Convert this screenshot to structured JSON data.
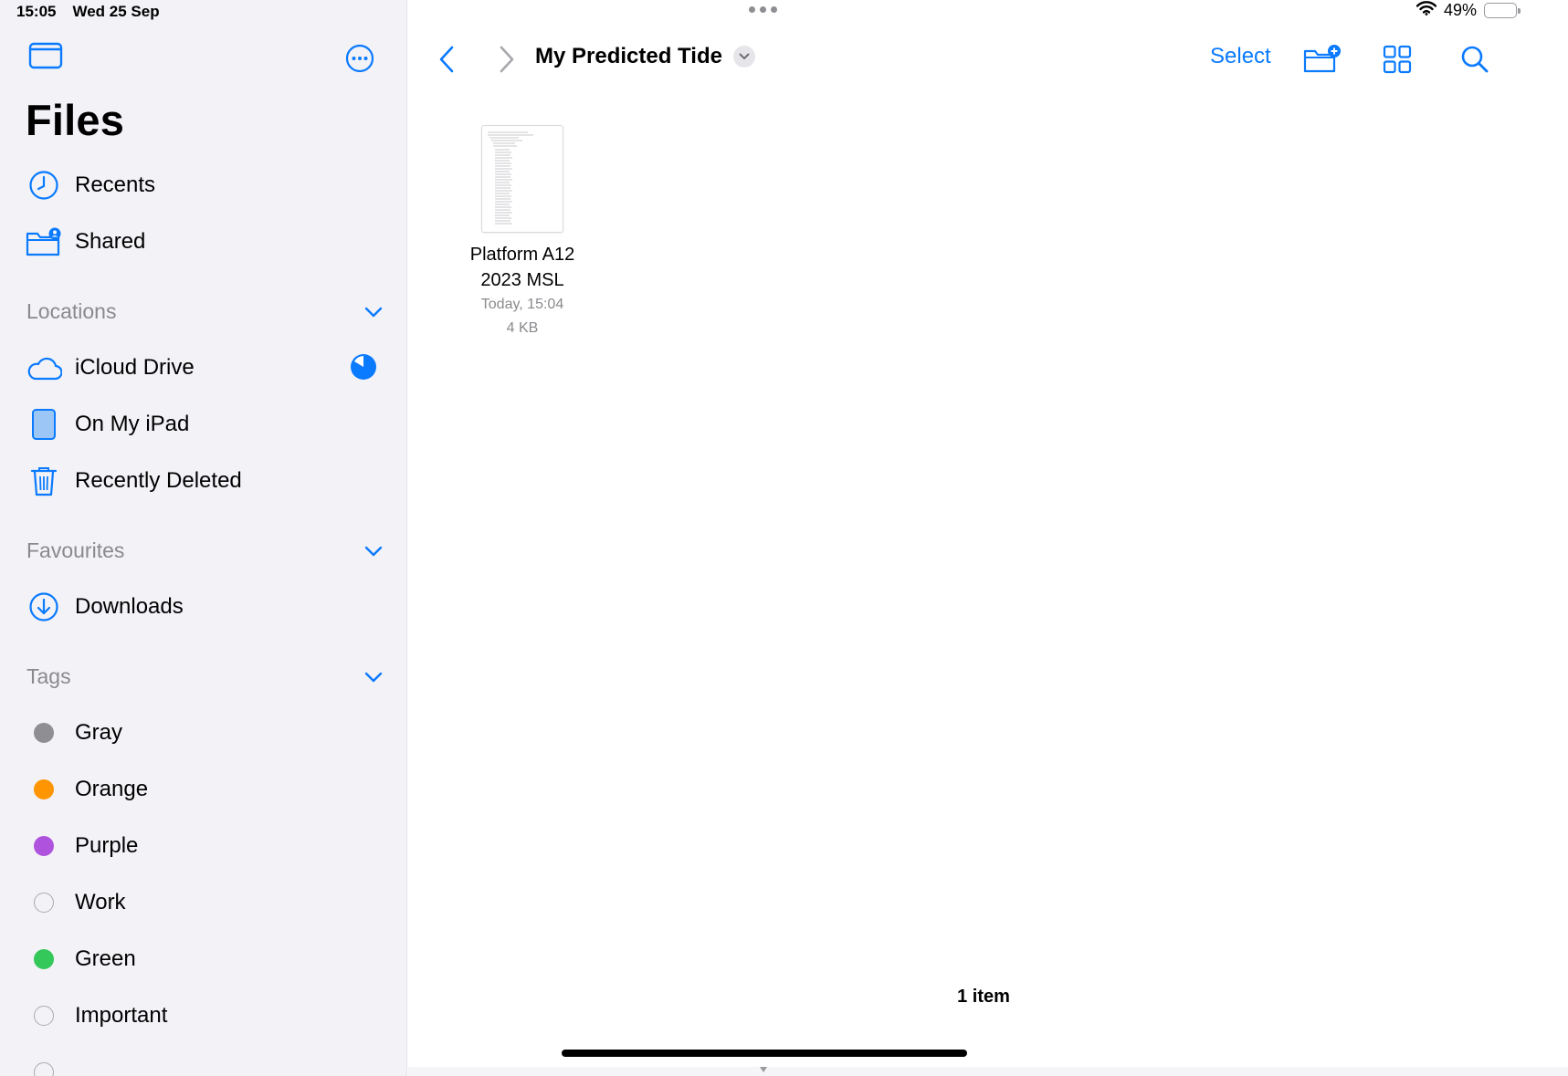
{
  "status_bar": {
    "time": "15:05",
    "date": "Wed 25 Sep",
    "battery_percent": "49%",
    "battery_level": 0.49
  },
  "sidebar": {
    "title": "Files",
    "top_items": [
      {
        "label": "Recents",
        "icon": "clock-icon"
      },
      {
        "label": "Shared",
        "icon": "shared-folder-icon"
      }
    ],
    "sections": {
      "locations": {
        "label": "Locations",
        "items": [
          {
            "label": "iCloud Drive",
            "icon": "cloud-icon"
          },
          {
            "label": "On My iPad",
            "icon": "ipad-icon"
          },
          {
            "label": "Recently Deleted",
            "icon": "trash-icon"
          }
        ]
      },
      "favourites": {
        "label": "Favourites",
        "items": [
          {
            "label": "Downloads",
            "icon": "download-icon"
          }
        ]
      },
      "tags": {
        "label": "Tags",
        "items": [
          {
            "label": "Gray",
            "color": "#8e8e93"
          },
          {
            "label": "Orange",
            "color": "#ff9500"
          },
          {
            "label": "Purple",
            "color": "#af52de"
          },
          {
            "label": "Work",
            "color": ""
          },
          {
            "label": "Green",
            "color": "#34c759"
          },
          {
            "label": "Important",
            "color": ""
          }
        ]
      }
    }
  },
  "toolbar": {
    "folder_title": "My Predicted Tide",
    "select_label": "Select"
  },
  "files": [
    {
      "name_line1": "Platform A12",
      "name_line2": "2023 MSL",
      "date": "Today, 15:04",
      "size": "4 KB"
    }
  ],
  "footer": {
    "item_count": "1 item"
  },
  "colors": {
    "accent": "#0a7aff",
    "sidebar_bg": "#f2f2f7",
    "secondary_text": "#8a8a8e"
  }
}
